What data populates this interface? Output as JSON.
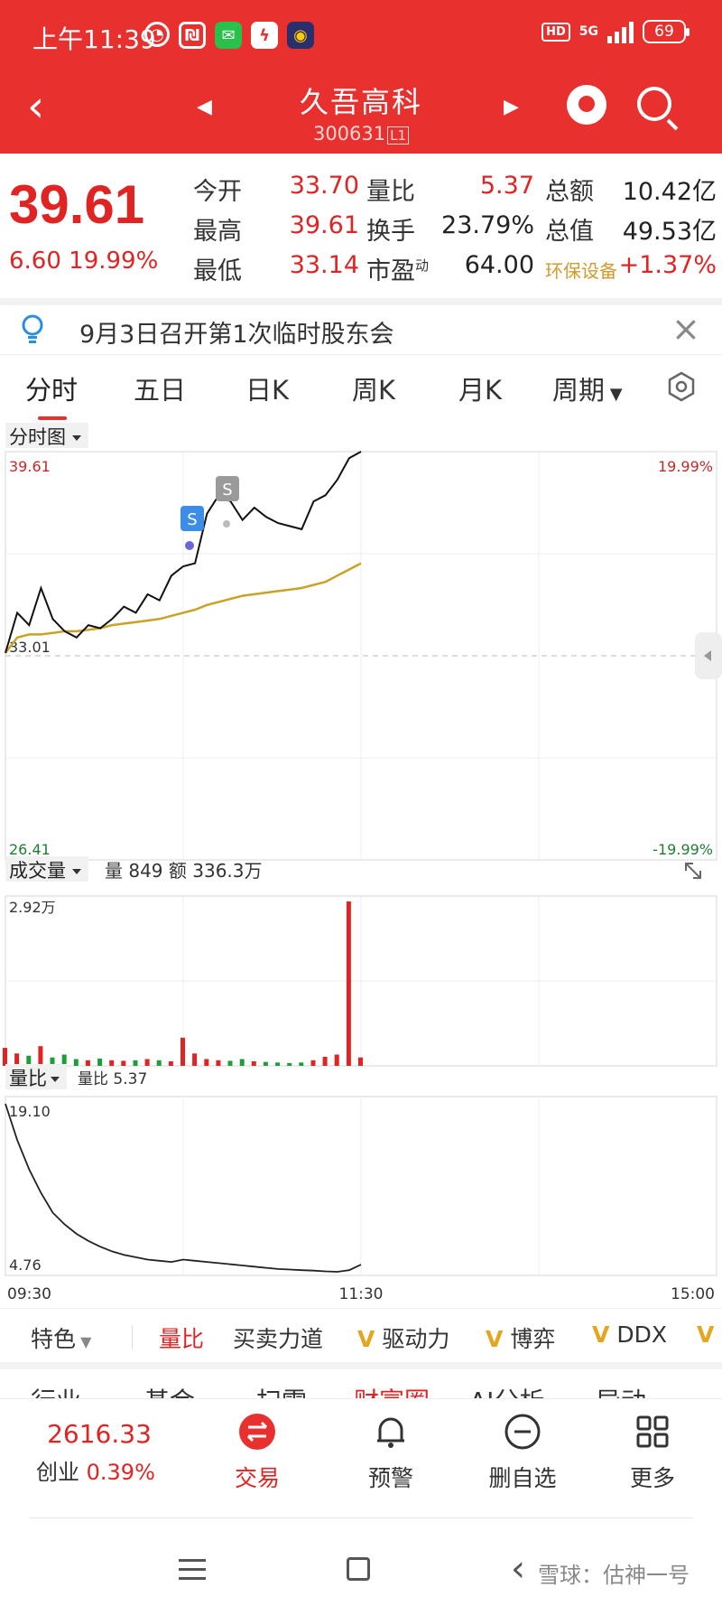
{
  "status_bar": {
    "time": "上午11:39",
    "network": "5G",
    "hd": "HD",
    "battery": "69"
  },
  "header": {
    "title": "久吾高科",
    "code": "300631",
    "code_badge": "L1"
  },
  "quote": {
    "price": "39.61",
    "change": "6.60",
    "change_pct": "19.99%",
    "rows": [
      {
        "l1": "今开",
        "v1": "33.70",
        "l2": "量比",
        "v2": "5.37",
        "l3": "总额",
        "v3": "10.42亿"
      },
      {
        "l1": "最高",
        "v1": "39.61",
        "l2": "换手",
        "v2": "23.79%",
        "l3": "总值",
        "v3": "49.53亿"
      },
      {
        "l1": "最低",
        "v1": "33.14",
        "l2": "市盈",
        "l2_sup": "动",
        "v2": "64.00",
        "l3": "环保设备",
        "v3": "+1.37%"
      }
    ]
  },
  "notice": {
    "text": "9月3日召开第1次临时股东会"
  },
  "tabs": [
    "分时",
    "五日",
    "日K",
    "周K",
    "月K",
    "周期"
  ],
  "chart": {
    "main_title": "分时图",
    "price_high": "39.61",
    "price_base": "33.01",
    "price_low": "26.41",
    "pct_high": "19.99%",
    "pct_low": "-19.99%",
    "signal_label": "S",
    "volume_title": "成交量",
    "volume_info": "量 849  额 336.3万",
    "volume_max": "2.92万",
    "ratio_title": "量比",
    "ratio_info": "量比 5.37",
    "ratio_max": "19.10",
    "ratio_min": "4.76",
    "time_start": "09:30",
    "time_mid": "11:30",
    "time_end": "15:00"
  },
  "chart_data": {
    "type": "line",
    "series": [
      {
        "values": [
          33.1,
          34.4,
          34.0,
          35.2,
          34.2,
          33.8,
          33.6,
          34.0,
          33.9,
          34.2,
          34.6,
          34.4,
          35.0,
          34.8,
          35.6,
          35.9,
          36.0,
          37.6,
          38.2,
          38.0,
          37.4,
          37.8,
          37.5,
          37.3,
          37.2,
          37.1,
          38.0,
          38.2,
          38.7,
          39.4,
          39.61
        ]
      },
      {
        "values": [
          33.1,
          33.6,
          33.7,
          33.7,
          33.75,
          33.8,
          33.8,
          33.85,
          33.9,
          34.0,
          34.05,
          34.1,
          34.15,
          34.2,
          34.3,
          34.4,
          34.5,
          34.65,
          34.75,
          34.85,
          34.95,
          35.0,
          35.05,
          35.1,
          35.15,
          35.2,
          35.3,
          35.4,
          35.6,
          35.8,
          36.0
        ]
      }
    ],
    "volume": [
      0.32,
      0.22,
      0.18,
      0.35,
      0.15,
      0.2,
      0.12,
      0.1,
      0.13,
      0.1,
      0.09,
      0.1,
      0.12,
      0.1,
      0.08,
      0.5,
      0.22,
      0.12,
      0.1,
      0.09,
      0.12,
      0.08,
      0.07,
      0.06,
      0.05,
      0.06,
      0.1,
      0.16,
      0.2,
      2.92,
      0.15
    ],
    "ratio": [
      19.1,
      16.0,
      13.5,
      11.5,
      9.8,
      8.8,
      8.0,
      7.4,
      6.9,
      6.5,
      6.2,
      6.0,
      5.8,
      5.7,
      5.6,
      5.8,
      5.7,
      5.6,
      5.5,
      5.4,
      5.3,
      5.2,
      5.1,
      5.0,
      4.95,
      4.9,
      4.86,
      4.8,
      4.76,
      4.9,
      5.37
    ],
    "ylim": [
      26.41,
      39.61
    ],
    "colors": {
      "price": "#111111",
      "avg": "#c9a227",
      "up": "#e02424",
      "down": "#1e9e3a"
    }
  },
  "features": {
    "special": "特色",
    "items": [
      "量比",
      "买卖力道",
      "驱动力",
      "博弈",
      "DDX"
    ]
  },
  "cut_row": [
    "行业",
    "基金",
    "扫雷",
    "财富圈",
    "AI分析",
    "异动"
  ],
  "toolbar": {
    "index_value": "2616.33",
    "index_name": "创业",
    "index_pct": "0.39%",
    "trade": "交易",
    "alert": "预警",
    "remove": "删自选",
    "more": "更多"
  },
  "watermark": "雪球：估神一号"
}
